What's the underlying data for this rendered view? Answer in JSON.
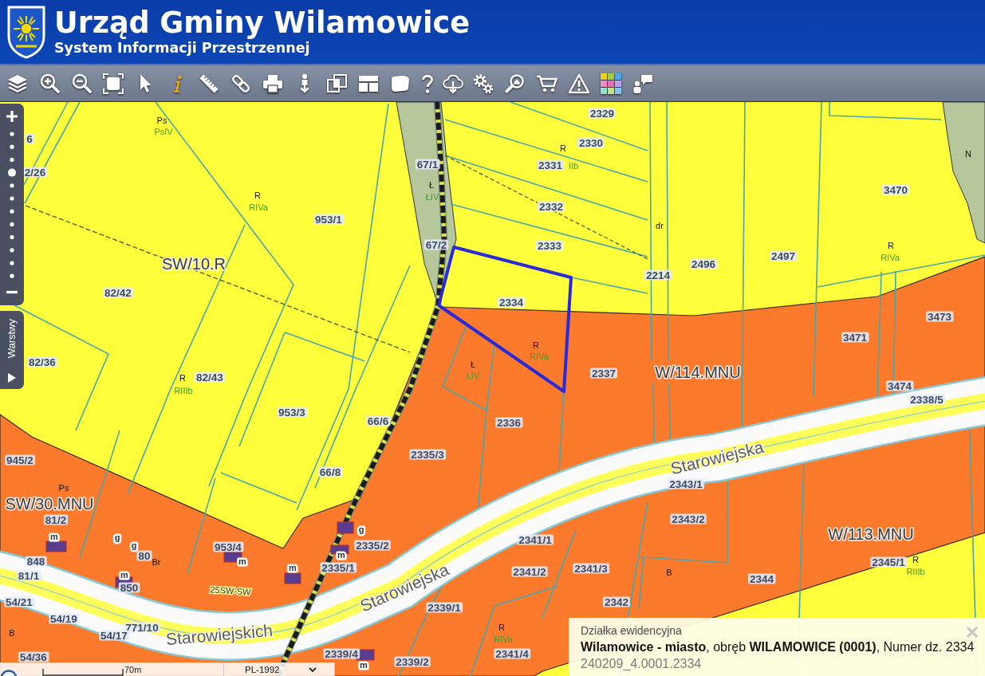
{
  "header": {
    "title": "Urząd Gminy Wilamowice",
    "subtitle": "System Informacji Przestrzennej"
  },
  "zoom_slider": {
    "level": 0.73
  },
  "layers_tab": {
    "label": "Warstwy",
    "expanded": false
  },
  "map": {
    "zone_labels": [
      "SW/10.R",
      "W/114.MNU",
      "SW/30.MNU",
      "W/113.MNU"
    ],
    "parcels": [
      {
        "number": "6",
        "selected": false
      },
      {
        "number": "2/26",
        "selected": false
      },
      {
        "number": "67/1",
        "selected": false
      },
      {
        "number": "67/2",
        "selected": false
      },
      {
        "number": "953/1",
        "selected": false
      },
      {
        "number": "82/42",
        "selected": false
      },
      {
        "number": "82/36",
        "selected": false
      },
      {
        "number": "82/43",
        "selected": false
      },
      {
        "number": "953/3",
        "selected": false
      },
      {
        "number": "66/6",
        "selected": false
      },
      {
        "number": "66/8",
        "selected": false
      },
      {
        "number": "945/2",
        "selected": false
      },
      {
        "number": "81/2",
        "selected": false
      },
      {
        "number": "953/4",
        "selected": false
      },
      {
        "number": "80",
        "selected": false
      },
      {
        "number": "848",
        "selected": false
      },
      {
        "number": "81/1",
        "selected": false
      },
      {
        "number": "850",
        "selected": false
      },
      {
        "number": "54/21",
        "selected": false
      },
      {
        "number": "54/19",
        "selected": false
      },
      {
        "number": "771/10",
        "selected": false
      },
      {
        "number": "54/17",
        "selected": false
      },
      {
        "number": "54/36",
        "selected": false
      },
      {
        "number": "2335/2",
        "selected": false
      },
      {
        "number": "2335/1",
        "selected": false
      },
      {
        "number": "2339/1",
        "selected": false
      },
      {
        "number": "2339/4",
        "selected": false
      },
      {
        "number": "2339/2",
        "selected": false
      },
      {
        "number": "2329",
        "selected": false
      },
      {
        "number": "2330",
        "selected": false
      },
      {
        "number": "2331",
        "selected": false
      },
      {
        "number": "2332",
        "selected": false
      },
      {
        "number": "2333",
        "selected": false
      },
      {
        "number": "2334",
        "selected": true
      },
      {
        "number": "2214",
        "selected": false
      },
      {
        "number": "2496",
        "selected": false
      },
      {
        "number": "2497",
        "selected": false
      },
      {
        "number": "3470",
        "selected": false
      },
      {
        "number": "3473",
        "selected": false
      },
      {
        "number": "3471",
        "selected": false
      },
      {
        "number": "2337",
        "selected": false
      },
      {
        "number": "2336",
        "selected": false
      },
      {
        "number": "2335/3",
        "selected": false
      },
      {
        "number": "3474",
        "selected": false
      },
      {
        "number": "2338/5",
        "selected": false
      },
      {
        "number": "2343/1",
        "selected": false
      },
      {
        "number": "2341/1",
        "selected": false
      },
      {
        "number": "2343/2",
        "selected": false
      },
      {
        "number": "2341/2",
        "selected": false
      },
      {
        "number": "2341/3",
        "selected": false
      },
      {
        "number": "2344",
        "selected": false
      },
      {
        "number": "2342",
        "selected": false
      },
      {
        "number": "2345/1",
        "selected": false
      },
      {
        "number": "2341/4",
        "selected": false
      }
    ],
    "land_uses": [
      {
        "use": "Ps",
        "soil_class": "PsIV"
      },
      {
        "use": "R",
        "soil_class": "RIVa"
      },
      {
        "use": "Ł",
        "soil_class": "ŁIV"
      },
      {
        "use": "R",
        "soil_class": "IIb"
      },
      {
        "use": "dr"
      },
      {
        "use": "R",
        "soil_class": "RIVa"
      },
      {
        "use": "N"
      },
      {
        "use": "R",
        "soil_class": "RIVa"
      },
      {
        "use": "Ł",
        "soil_class": "ŁIV"
      },
      {
        "use": "R",
        "soil_class": "RIIIb"
      },
      {
        "use": "R",
        "soil_class": "RIIIb"
      },
      {
        "use": "Ps"
      },
      {
        "use": "Br"
      },
      {
        "use": "B"
      },
      {
        "use": "R",
        "soil_class": "RIVa"
      },
      {
        "use": "B"
      }
    ],
    "building_symbols": [
      "m",
      "m",
      "m",
      "g",
      "m",
      "m",
      "m",
      "g",
      "g"
    ],
    "streets": [
      "Starowiejska",
      "Starowiejska",
      "Starowiejskich"
    ],
    "road_codes": [
      "25SW-SW"
    ]
  },
  "scale_bar": {
    "label": "70m"
  },
  "projection": {
    "value": "PL-1992"
  },
  "info_panel": {
    "title": "Działka ewidencyjna",
    "description": "**Wilamowice - miasto**, obręb **WILAMOWICE (0001)**, Numer dz. 2334",
    "parcel_id": "240209_4.0001.2334"
  }
}
